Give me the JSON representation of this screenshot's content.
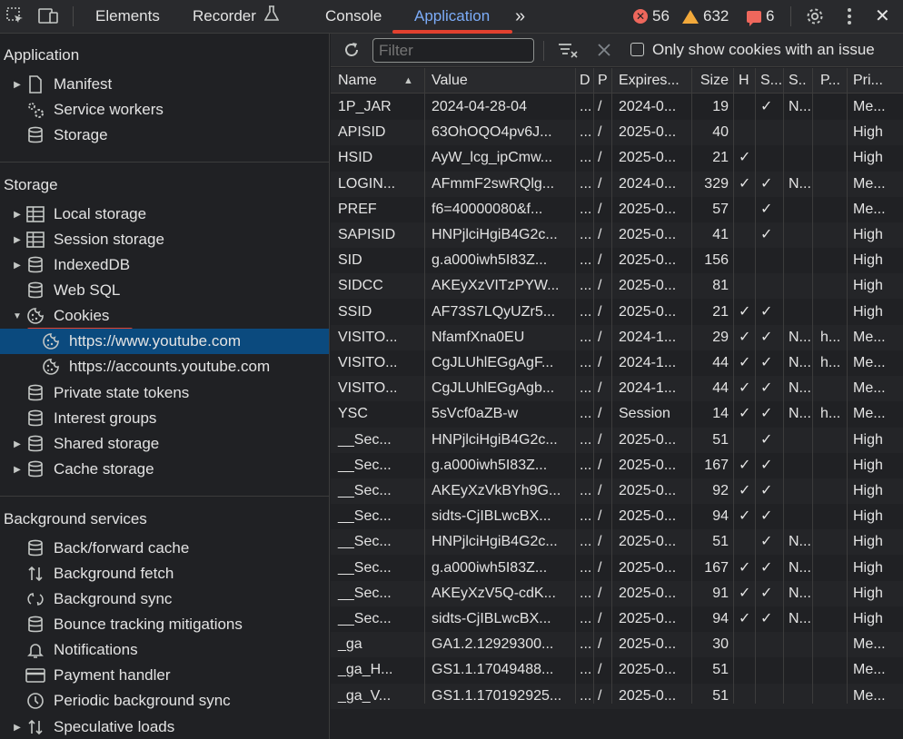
{
  "topbar": {
    "tabs": [
      "Elements",
      "Recorder",
      "Console",
      "Application"
    ],
    "more": "»",
    "errors": "56",
    "warnings": "632",
    "messages": "6",
    "close": "✕"
  },
  "sidebar": {
    "application_head": "Application",
    "application_items": [
      "Manifest",
      "Service workers",
      "Storage"
    ],
    "storage_head": "Storage",
    "storage_items": [
      "Local storage",
      "Session storage",
      "IndexedDB",
      "Web SQL",
      "Cookies",
      "https://www.youtube.com",
      "https://accounts.youtube.com",
      "Private state tokens",
      "Interest groups",
      "Shared storage",
      "Cache storage"
    ],
    "background_head": "Background services",
    "background_items": [
      "Back/forward cache",
      "Background fetch",
      "Background sync",
      "Bounce tracking mitigations",
      "Notifications",
      "Payment handler",
      "Periodic background sync",
      "Speculative loads"
    ]
  },
  "toolbar": {
    "filter_placeholder": "Filter",
    "only_issue_label": "Only show cookies with an issue"
  },
  "table": {
    "headers": [
      "Name",
      "Value",
      "D",
      "P",
      "Expires...",
      "Size",
      "H",
      "S...",
      "S..",
      "P...",
      "Pri..."
    ],
    "rows": [
      [
        "1P_JAR",
        "2024-04-28-04",
        "...",
        "/",
        "2024-0...",
        "19",
        "",
        "✓",
        "N...",
        "",
        "Me..."
      ],
      [
        "APISID",
        "63OhOQO4pv6J...",
        "...",
        "/",
        "2025-0...",
        "40",
        "",
        "",
        "",
        "",
        "High"
      ],
      [
        "HSID",
        "AyW_lcg_ipCmw...",
        "...",
        "/",
        "2025-0...",
        "21",
        "✓",
        "",
        "",
        "",
        "High"
      ],
      [
        "LOGIN...",
        "AFmmF2swRQlg...",
        "...",
        "/",
        "2024-0...",
        "329",
        "✓",
        "✓",
        "N...",
        "",
        "Me..."
      ],
      [
        "PREF",
        "f6=40000080&f...",
        "...",
        "/",
        "2025-0...",
        "57",
        "",
        "✓",
        "",
        "",
        "Me..."
      ],
      [
        "SAPISID",
        "HNPjlciHgiB4G2c...",
        "...",
        "/",
        "2025-0...",
        "41",
        "",
        "✓",
        "",
        "",
        "High"
      ],
      [
        "SID",
        "g.a000iwh5I83Z...",
        "...",
        "/",
        "2025-0...",
        "156",
        "",
        "",
        "",
        "",
        "High"
      ],
      [
        "SIDCC",
        "AKEyXzVITzPYW...",
        "...",
        "/",
        "2025-0...",
        "81",
        "",
        "",
        "",
        "",
        "High"
      ],
      [
        "SSID",
        "AF73S7LQyUZr5...",
        "...",
        "/",
        "2025-0...",
        "21",
        "✓",
        "✓",
        "",
        "",
        "High"
      ],
      [
        "VISITO...",
        "NfamfXna0EU",
        "...",
        "/",
        "2024-1...",
        "29",
        "✓",
        "✓",
        "N...",
        "h...",
        "Me..."
      ],
      [
        "VISITO...",
        "CgJLUhlEGgAgF...",
        "...",
        "/",
        "2024-1...",
        "44",
        "✓",
        "✓",
        "N...",
        "h...",
        "Me..."
      ],
      [
        "VISITO...",
        "CgJLUhlEGgAgb...",
        "...",
        "/",
        "2024-1...",
        "44",
        "✓",
        "✓",
        "N...",
        "",
        "Me..."
      ],
      [
        "YSC",
        "5sVcf0aZB-w",
        "...",
        "/",
        "Session",
        "14",
        "✓",
        "✓",
        "N...",
        "h...",
        "Me..."
      ],
      [
        "__Sec...",
        "HNPjlciHgiB4G2c...",
        "...",
        "/",
        "2025-0...",
        "51",
        "",
        "✓",
        "",
        "",
        "High"
      ],
      [
        "__Sec...",
        "g.a000iwh5I83Z...",
        "...",
        "/",
        "2025-0...",
        "167",
        "✓",
        "✓",
        "",
        "",
        "High"
      ],
      [
        "__Sec...",
        "AKEyXzVkBYh9G...",
        "...",
        "/",
        "2025-0...",
        "92",
        "✓",
        "✓",
        "",
        "",
        "High"
      ],
      [
        "__Sec...",
        "sidts-CjIBLwcBX...",
        "...",
        "/",
        "2025-0...",
        "94",
        "✓",
        "✓",
        "",
        "",
        "High"
      ],
      [
        "__Sec...",
        "HNPjlciHgiB4G2c...",
        "...",
        "/",
        "2025-0...",
        "51",
        "",
        "✓",
        "N...",
        "",
        "High"
      ],
      [
        "__Sec...",
        "g.a000iwh5I83Z...",
        "...",
        "/",
        "2025-0...",
        "167",
        "✓",
        "✓",
        "N...",
        "",
        "High"
      ],
      [
        "__Sec...",
        "AKEyXzV5Q-cdK...",
        "...",
        "/",
        "2025-0...",
        "91",
        "✓",
        "✓",
        "N...",
        "",
        "High"
      ],
      [
        "__Sec...",
        "sidts-CjIBLwcBX...",
        "...",
        "/",
        "2025-0...",
        "94",
        "✓",
        "✓",
        "N...",
        "",
        "High"
      ],
      [
        "_ga",
        "GA1.2.12929300...",
        "...",
        "/",
        "2025-0...",
        "30",
        "",
        "",
        "",
        "",
        "Me..."
      ],
      [
        "_ga_H...",
        "GS1.1.17049488...",
        "...",
        "/",
        "2025-0...",
        "51",
        "",
        "",
        "",
        "",
        "Me..."
      ],
      [
        "_ga_V...",
        "GS1.1.170192925...",
        "...",
        "/",
        "2025-0...",
        "51",
        "",
        "",
        "",
        "",
        "Me..."
      ]
    ]
  },
  "colors": {
    "accent": "#7cacf8",
    "selection": "#0b4a7e",
    "annotation_red": "#e2412f",
    "error": "#ee675c",
    "warning": "#f2a93b"
  }
}
